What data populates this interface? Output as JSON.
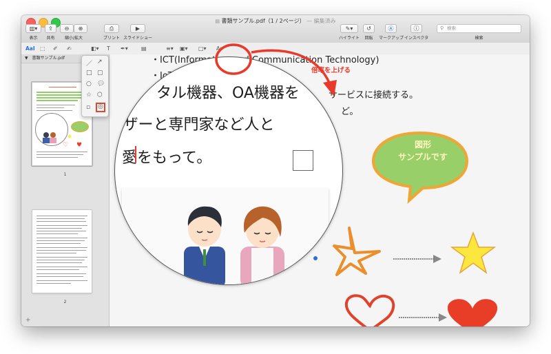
{
  "window": {
    "title": "書類サンプル.pdf（1 / 2ページ）",
    "title_status": "— 編集済み"
  },
  "toolbar": {
    "view_label": "表示",
    "share_label": "共有",
    "zoom_label": "縮小/拡大",
    "print_label": "プリント",
    "slideshow_label": "スライドショー",
    "highlight_label": "ハイライト",
    "rotate_label": "回転",
    "markup_label": "マークアップ",
    "inspector_label": "インスペクタ",
    "search_label": "検索",
    "search_placeholder": "検索"
  },
  "markup": {
    "text_tool": "AaI"
  },
  "sidebar": {
    "file_name": "書類サンプル.pdf",
    "pages": [
      {
        "number": "1"
      },
      {
        "number": "2"
      }
    ]
  },
  "document": {
    "line1": "・ICT(Information and Communication Technology)",
    "line2": "・IoT",
    "line3": "サービスに接続する。",
    "line4": "ど。",
    "loupe_line1": "タル機器、OA機器を",
    "loupe_line2": "ーザーと専門家など人と",
    "loupe_line3": "愛をもって。",
    "annotation_label": "倍率を上げる",
    "bubble_line1": "図形",
    "bubble_line2": "サンプルです"
  },
  "colors": {
    "annotation_red": "#e8392a",
    "bubble_green": "#99cf69",
    "bubble_border": "#f0a535",
    "star_yellow": "#fbe73e",
    "heart_red": "#e83d27"
  }
}
